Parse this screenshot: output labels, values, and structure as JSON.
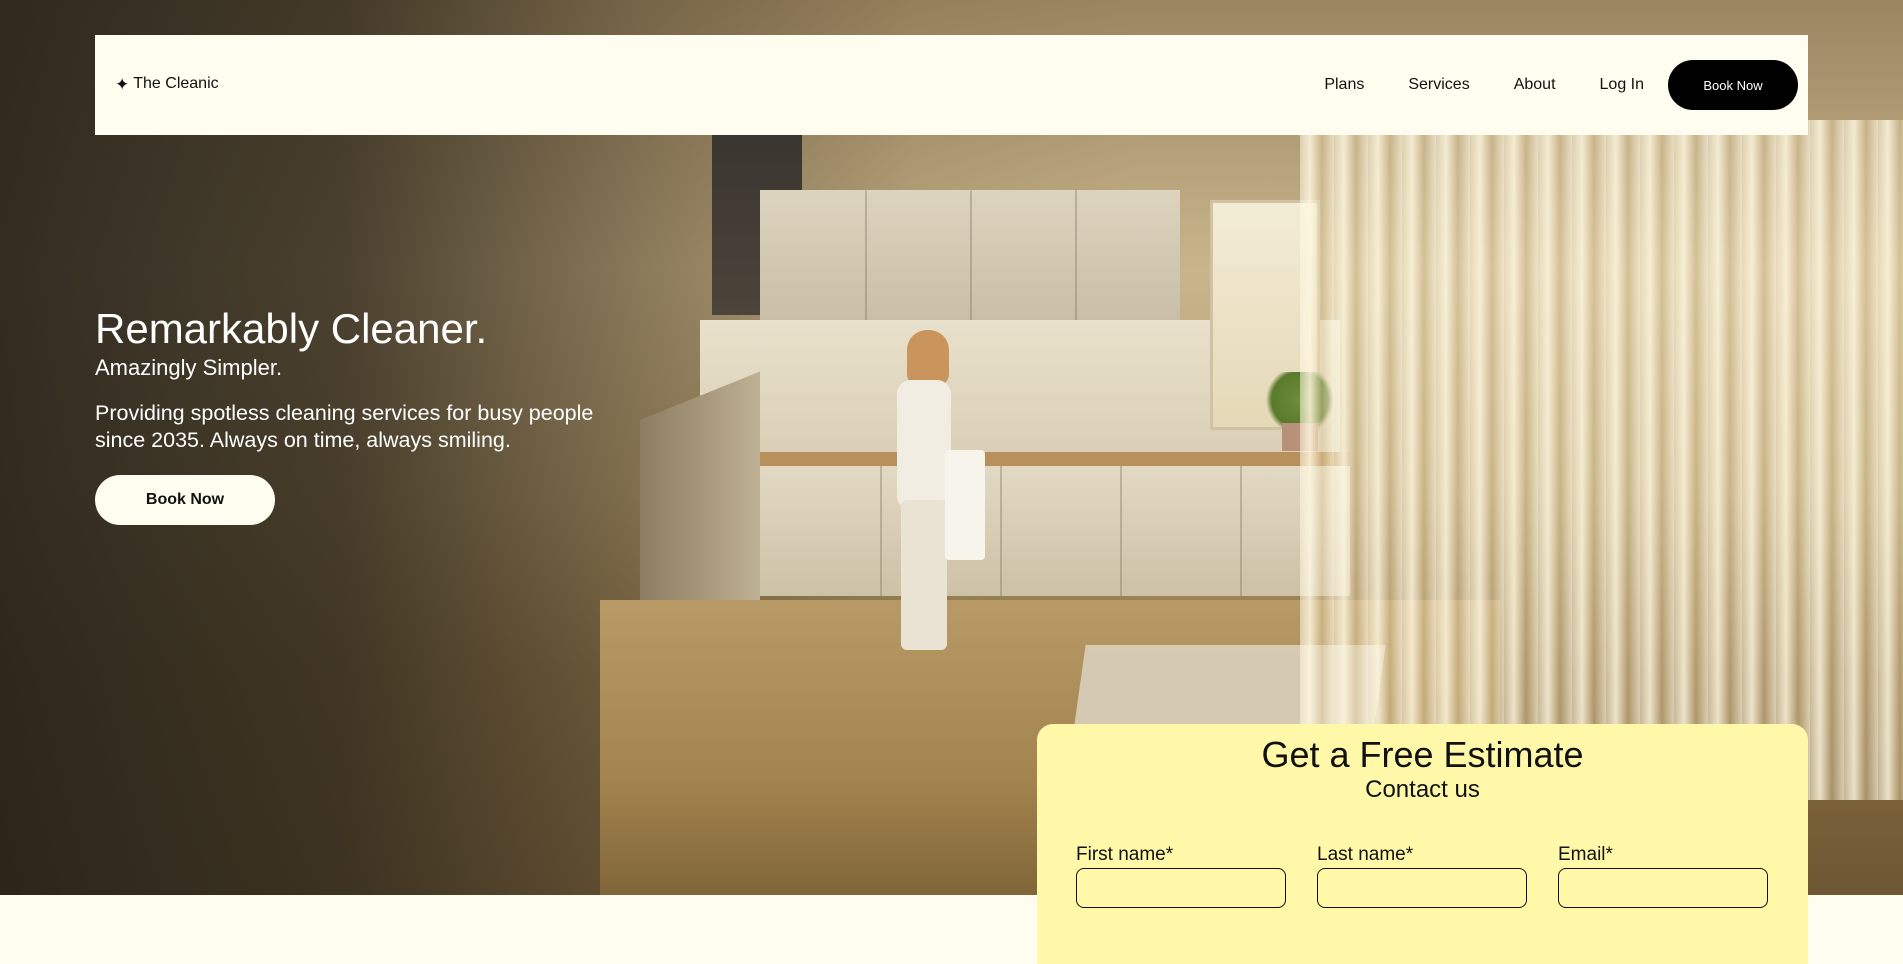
{
  "navbar": {
    "brand": "The Cleanic",
    "links": [
      "Plans",
      "Services",
      "About",
      "Log In"
    ],
    "book_label": "Book Now"
  },
  "hero": {
    "title": "Remarkably Cleaner.",
    "subtitle": "Amazingly Simpler.",
    "description": "Providing spotless cleaning services for busy people since 2035. Always on time, always smiling.",
    "book_label": "Book Now"
  },
  "estimate": {
    "title": "Get a Free Estimate",
    "subtitle": "Contact us",
    "fields": [
      {
        "label": "First name*",
        "value": ""
      },
      {
        "label": "Last name*",
        "value": ""
      },
      {
        "label": "Email*",
        "value": ""
      }
    ]
  },
  "icons": {
    "brand_icon": "sparkle-icon"
  },
  "colors": {
    "page_bg": "#fffdf0",
    "estimate_bg": "#fff8a8",
    "button_dark": "#000000"
  }
}
